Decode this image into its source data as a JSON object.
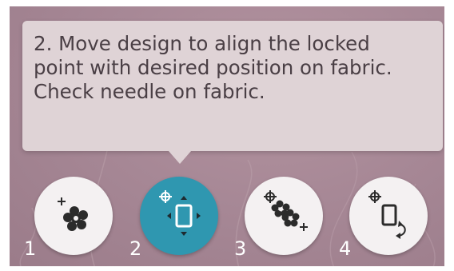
{
  "tooltip": {
    "text": "2. Move design to align the locked\npoint with desired position on fabric.\nCheck needle on fabric."
  },
  "steps": [
    {
      "number": "1",
      "icon": "crosshair-flower-icon",
      "active": false
    },
    {
      "number": "2",
      "icon": "crosshair-move-hoop-icon",
      "active": true
    },
    {
      "number": "3",
      "icon": "crosshair-two-flowers-icon",
      "active": false
    },
    {
      "number": "4",
      "icon": "crosshair-rotate-hoop-icon",
      "active": false
    }
  ],
  "colors": {
    "background": "#a78896",
    "tooltip": "#dfd3d6",
    "active_button": "#2f97b0",
    "button": "#f4f1f2",
    "icon_dark": "#2b2b2b"
  }
}
